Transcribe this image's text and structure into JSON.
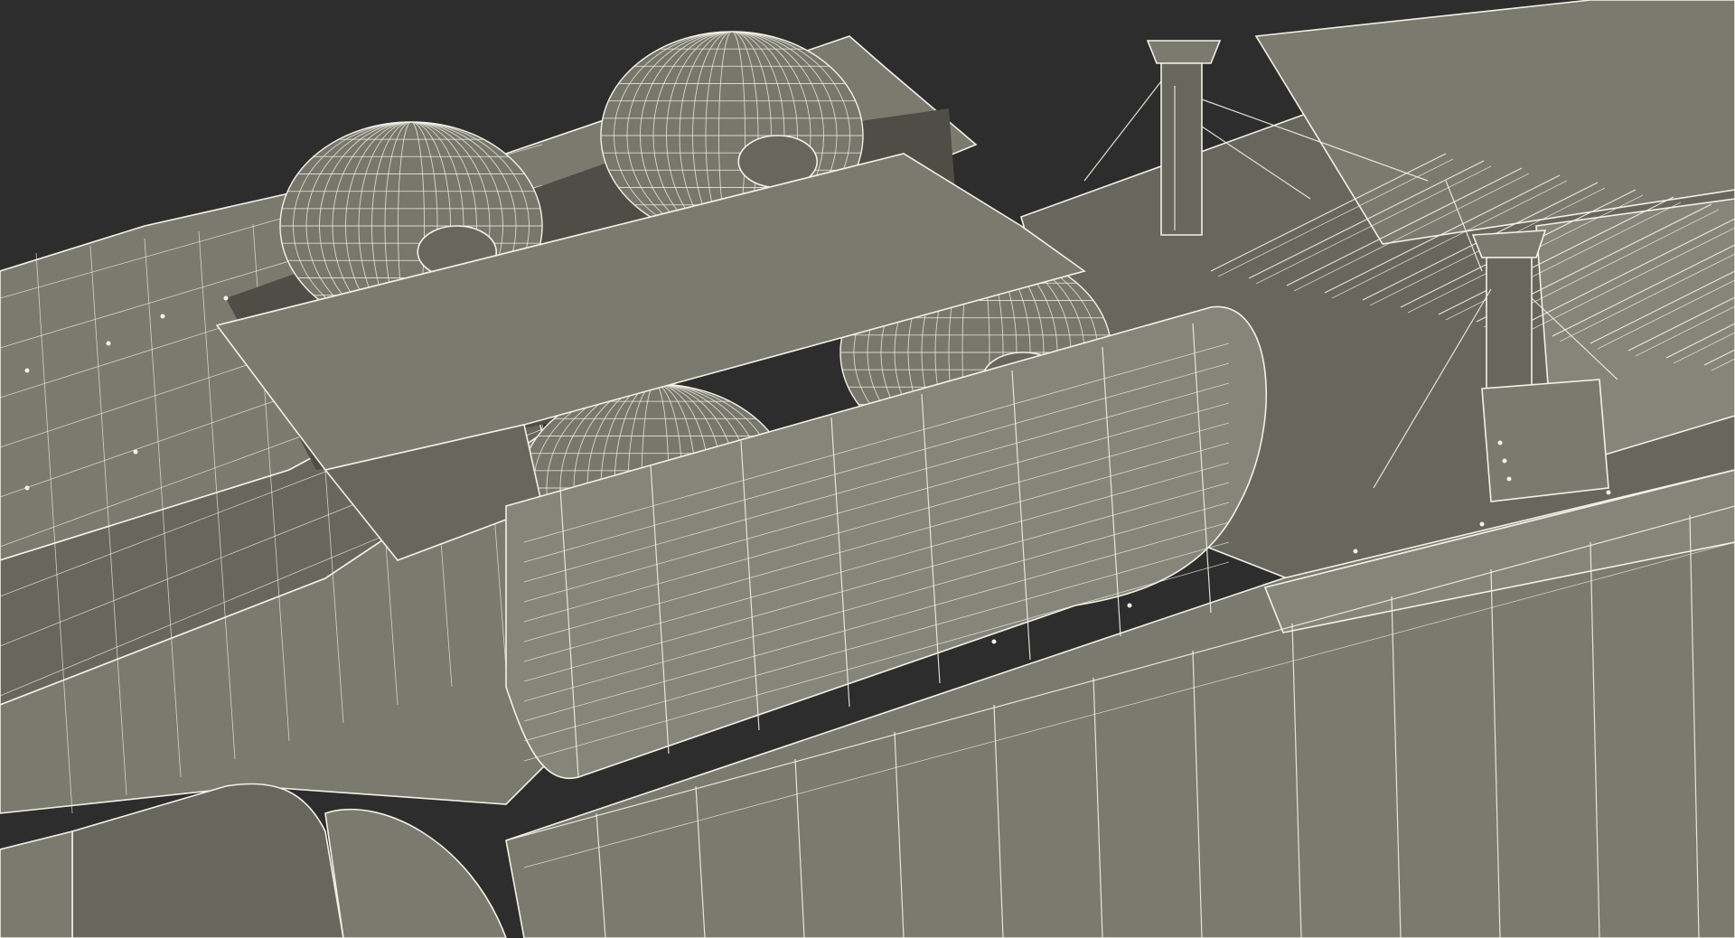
{
  "scene": {
    "subject": "",
    "colors": {
      "background": "#2d2d2d",
      "surface": "#7a7a6f",
      "surface_dark": "#67675d",
      "shadow": "#4e4e46",
      "wireframe": "#f2f1e6"
    }
  }
}
